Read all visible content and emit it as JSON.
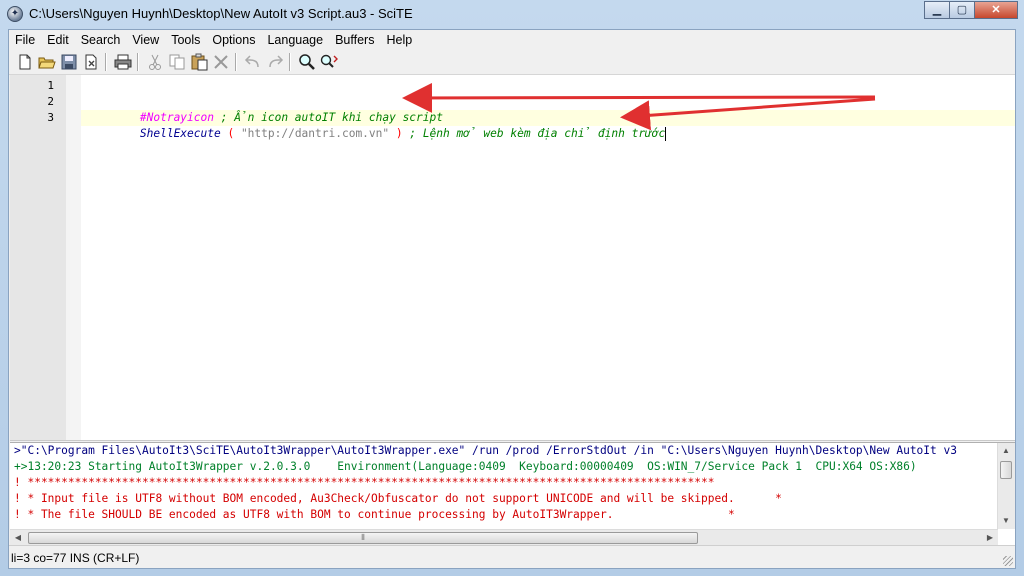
{
  "window": {
    "title": "C:\\Users\\Nguyen Huynh\\Desktop\\New AutoIt v3 Script.au3 - SciTE",
    "minimize_icon": "minimize-icon",
    "maximize_icon": "maximize-icon",
    "close_icon": "close-icon"
  },
  "menu": [
    "File",
    "Edit",
    "Search",
    "View",
    "Tools",
    "Options",
    "Language",
    "Buffers",
    "Help"
  ],
  "toolbar": {
    "icons": [
      "new-file-icon",
      "open-folder-icon",
      "save-icon",
      "close-file-icon",
      "print-icon",
      "cut-icon",
      "copy-icon",
      "paste-icon",
      "delete-icon",
      "undo-icon",
      "redo-icon",
      "find-icon",
      "replace-icon"
    ]
  },
  "editor": {
    "line_numbers": [
      "1",
      "2",
      "3"
    ],
    "line2": {
      "directive": "#Notrayicon",
      "comment": " ; Ẩn icon autoIT khi chạy script"
    },
    "line3": {
      "func": "ShellExecute",
      "open": " ( ",
      "string": "\"http://dantri.com.vn\"",
      "close": " ) ",
      "comment": "; Lệnh mở web kèm địa chỉ định trước"
    }
  },
  "output": {
    "lines": [
      ">\"C:\\Program Files\\AutoIt3\\SciTE\\AutoIt3Wrapper\\AutoIt3Wrapper.exe\" /run /prod /ErrorStdOut /in \"C:\\Users\\Nguyen Huynh\\Desktop\\New AutoIt v3",
      "+>13:20:23 Starting AutoIt3Wrapper v.2.0.3.0    Environment(Language:0409  Keyboard:00000409  OS:WIN_7/Service Pack 1  CPU:X64 OS:X86)",
      "! ******************************************************************************************************",
      "! * Input file is UTF8 without BOM encoded, Au3Check/Obfuscator do not support UNICODE and will be skipped.      *",
      "! * The file SHOULD BE encoded as UTF8 with BOM to continue processing by AutoIT3Wrapper.                 *"
    ]
  },
  "status": {
    "text": "li=3 co=77 INS (CR+LF)"
  },
  "colors": {
    "directive": "#f000ff",
    "comment": "#008000",
    "function": "#000090",
    "operator": "#ff0000",
    "string": "#808080",
    "output_cmd": "#000080",
    "output_info": "#00802a",
    "output_error": "#d40000",
    "annotation_arrow": "#e03030",
    "caret_line": "#ffffe0"
  }
}
